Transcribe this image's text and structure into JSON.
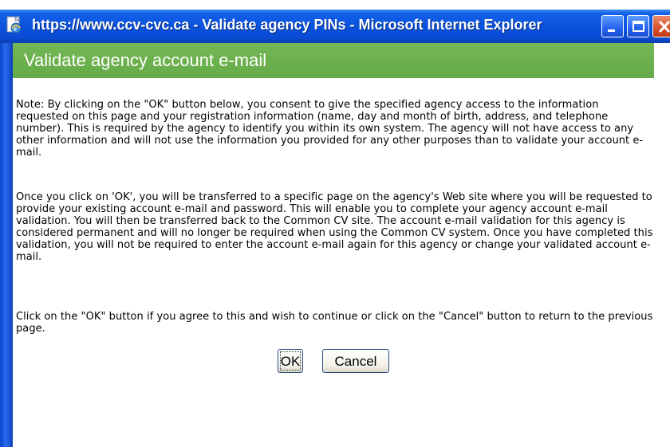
{
  "window": {
    "title": "https://www.ccv-cvc.ca - Validate agency PINs - Microsoft Internet Explorer",
    "controls": [
      "minimize-icon",
      "maximize-icon",
      "close-icon"
    ]
  },
  "page": {
    "header": "Validate agency account e-mail",
    "paragraphs": [
      "Note: By clicking on the \"OK\" button below, you consent to give the specified agency access to the information requested on this page and your registration information (name, day and month of birth, address, and telephone number). This is required by the agency to identify you within its own system. The agency will not have access to any other information and will not use the information you provided for any other purposes than to validate your account e-mail.",
      "Once you click on 'OK', you will be transferred to a specific page on the agency's Web site where you will be requested to provide your existing account e-mail and password. This will enable you to complete your agency account e-mail validation. You will then be transferred back to the Common CV site. The account e-mail validation for this agency is considered permanent and will no longer be required when using the Common CV system. Once you have completed this validation, you will not be required to enter the account e-mail again for this agency or change your validated account e-mail.",
      "Click on the \"OK\" button if you agree to this and wish to continue or click on the \"Cancel\" button to return to the previous page."
    ],
    "buttons": {
      "ok": "OK",
      "cancel": "Cancel"
    }
  },
  "colors": {
    "titlebar": "#0a52dd",
    "header_bar": "#6ab04c",
    "close_button": "#d8512c"
  }
}
